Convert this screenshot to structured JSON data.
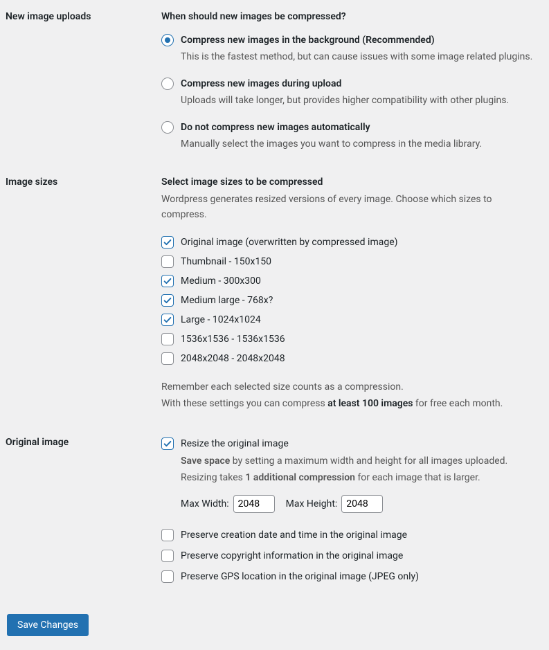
{
  "uploads": {
    "heading": "New image uploads",
    "question": "When should new images be compressed?",
    "options": [
      {
        "label": "Compress new images in the background (Recommended)",
        "desc": "This is the fastest method, but can cause issues with some image related plugins.",
        "checked": true
      },
      {
        "label": "Compress new images during upload",
        "desc": "Uploads will take longer, but provides higher compatibility with other plugins.",
        "checked": false
      },
      {
        "label": "Do not compress new images automatically",
        "desc": "Manually select the images you want to compress in the media library.",
        "checked": false
      }
    ]
  },
  "sizes": {
    "heading": "Image sizes",
    "title": "Select image sizes to be compressed",
    "sub": "Wordpress generates resized versions of every image. Choose which sizes to compress.",
    "items": [
      {
        "label": "Original image (overwritten by compressed image)",
        "checked": true
      },
      {
        "label": "Thumbnail - 150x150",
        "checked": false
      },
      {
        "label": "Medium - 300x300",
        "checked": true
      },
      {
        "label": "Medium large - 768x?",
        "checked": true
      },
      {
        "label": "Large - 1024x1024",
        "checked": true
      },
      {
        "label": "1536x1536 - 1536x1536",
        "checked": false
      },
      {
        "label": "2048x2048 - 2048x2048",
        "checked": false
      }
    ],
    "remember_line1": "Remember each selected size counts as a compression.",
    "remember_pre": "With these settings you can compress ",
    "remember_bold": "at least 100 images",
    "remember_post": " for free each month."
  },
  "original": {
    "heading": "Original image",
    "resize": {
      "label": "Resize the original image",
      "checked": true
    },
    "desc_bold1": "Save space",
    "desc_1": " by setting a maximum width and height for all images uploaded.",
    "desc_2_pre": "Resizing takes ",
    "desc_bold2": "1 additional compression",
    "desc_2_post": " for each image that is larger.",
    "maxw_label": "Max Width:",
    "maxw_value": "2048",
    "maxh_label": "Max Height:",
    "maxh_value": "2048",
    "preserve": [
      {
        "label": "Preserve creation date and time in the original image",
        "checked": false
      },
      {
        "label": "Preserve copyright information in the original image",
        "checked": false
      },
      {
        "label": "Preserve GPS location in the original image (JPEG only)",
        "checked": false
      }
    ]
  },
  "submit": {
    "label": "Save Changes"
  }
}
